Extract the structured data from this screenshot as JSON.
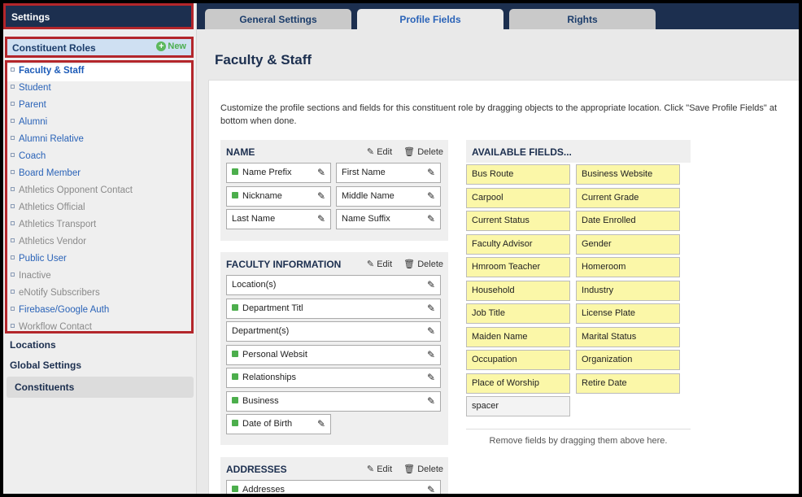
{
  "sidebar": {
    "title": "Settings",
    "roles_header": "Constituent Roles",
    "new_label": "New",
    "roles": [
      {
        "label": "Faculty & Staff",
        "state": "active"
      },
      {
        "label": "Student",
        "state": "normal"
      },
      {
        "label": "Parent",
        "state": "normal"
      },
      {
        "label": "Alumni",
        "state": "normal"
      },
      {
        "label": "Alumni Relative",
        "state": "normal"
      },
      {
        "label": "Coach",
        "state": "normal"
      },
      {
        "label": "Board Member",
        "state": "normal"
      },
      {
        "label": "Athletics Opponent Contact",
        "state": "inactive"
      },
      {
        "label": "Athletics Official",
        "state": "inactive"
      },
      {
        "label": "Athletics Transport",
        "state": "inactive"
      },
      {
        "label": "Athletics Vendor",
        "state": "inactive"
      },
      {
        "label": "Public User",
        "state": "normal"
      },
      {
        "label": "Inactive",
        "state": "inactive"
      },
      {
        "label": "eNotify Subscribers",
        "state": "inactive"
      },
      {
        "label": "Firebase/Google Auth",
        "state": "normal"
      },
      {
        "label": "Workflow Contact",
        "state": "inactive"
      }
    ],
    "locations_label": "Locations",
    "global_settings_label": "Global Settings",
    "constituents_label": "Constituents"
  },
  "tabs": [
    {
      "label": "General Settings",
      "selected": false
    },
    {
      "label": "Profile Fields",
      "selected": true
    },
    {
      "label": "Rights",
      "selected": false
    }
  ],
  "page_title": "Faculty & Staff",
  "description": "Customize the profile sections and fields for this constituent role by dragging objects to the appropriate location. Click \"Save Profile Fields\" at bottom when done.",
  "edit_label": "Edit",
  "delete_label": "Delete",
  "sections": {
    "name": {
      "title": "NAME",
      "fields": [
        {
          "label": "Name Prefix",
          "required": true
        },
        {
          "label": "First Name",
          "required": false
        },
        {
          "label": "Nickname",
          "required": true
        },
        {
          "label": "Middle Name",
          "required": false
        },
        {
          "label": "Last Name",
          "required": false
        },
        {
          "label": "Name Suffix",
          "required": false
        }
      ]
    },
    "faculty": {
      "title": "FACULTY INFORMATION",
      "fields": [
        {
          "label": "Location(s)",
          "required": false
        },
        {
          "label": "Department Titl",
          "required": true
        },
        {
          "label": "Department(s)",
          "required": false
        },
        {
          "label": "Personal Websit",
          "required": true
        },
        {
          "label": "Relationships",
          "required": true
        },
        {
          "label": "Business",
          "required": true
        },
        {
          "label": "Date of Birth",
          "required": true
        }
      ]
    },
    "addresses": {
      "title": "ADDRESSES",
      "fields": [
        {
          "label": "Addresses",
          "required": true
        }
      ]
    }
  },
  "available": {
    "title": "AVAILABLE FIELDS...",
    "fields": [
      "Bus Route",
      "Business Website",
      "Carpool",
      "Current Grade",
      "Current Status",
      "Date Enrolled",
      "Faculty Advisor",
      "Gender",
      "Hmroom Teacher",
      "Homeroom",
      "Household",
      "Industry",
      "Job Title",
      "License Plate",
      "Maiden Name",
      "Marital Status",
      "Occupation",
      "Organization",
      "Place of Worship",
      "Retire Date"
    ],
    "spacer_label": "spacer",
    "remove_note": "Remove fields by dragging them above here."
  }
}
